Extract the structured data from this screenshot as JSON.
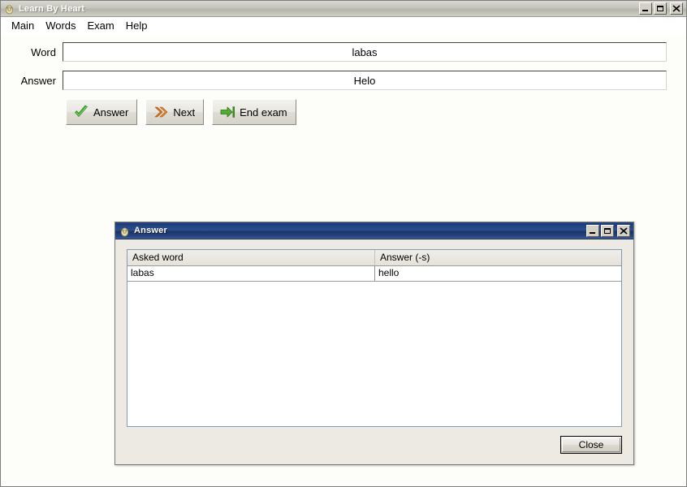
{
  "main_window": {
    "title": "Learn By Heart",
    "icon": "app-icon",
    "window_controls": [
      {
        "name": "minimize",
        "glyph": "_"
      },
      {
        "name": "maximize",
        "glyph": "□"
      },
      {
        "name": "close",
        "glyph": "×"
      }
    ],
    "menu": [
      {
        "label": "Main"
      },
      {
        "label": "Words"
      },
      {
        "label": "Exam"
      },
      {
        "label": "Help"
      }
    ],
    "fields": [
      {
        "label": "Word",
        "value": "labas",
        "placeholder": ""
      },
      {
        "label": "Answer",
        "value": "Helo",
        "placeholder": ""
      }
    ],
    "buttons": [
      {
        "label": "Answer",
        "icon": "green-check-icon"
      },
      {
        "label": "Next",
        "icon": "orange-double-chevron-icon"
      },
      {
        "label": "End exam",
        "icon": "green-arrow-to-bar-icon"
      }
    ]
  },
  "answer_dialog": {
    "title": "Answer",
    "icon": "app-icon",
    "window_controls": [
      {
        "name": "minimize",
        "glyph": "_"
      },
      {
        "name": "maximize",
        "glyph": "□"
      },
      {
        "name": "close",
        "glyph": "×"
      }
    ],
    "grid": {
      "columns": [
        "Asked word",
        "Answer (-s)"
      ],
      "rows": [
        {
          "asked_word": "labas",
          "answer": "hello"
        }
      ]
    },
    "close_label": "Close"
  },
  "colors": {
    "dialog_title_blue": "#1f3c78",
    "inactive_title_silver": "#c6c6bd",
    "accent_green": "#3aa02c",
    "accent_orange": "#e07b1e",
    "client_bg": "#fdfdfa"
  }
}
